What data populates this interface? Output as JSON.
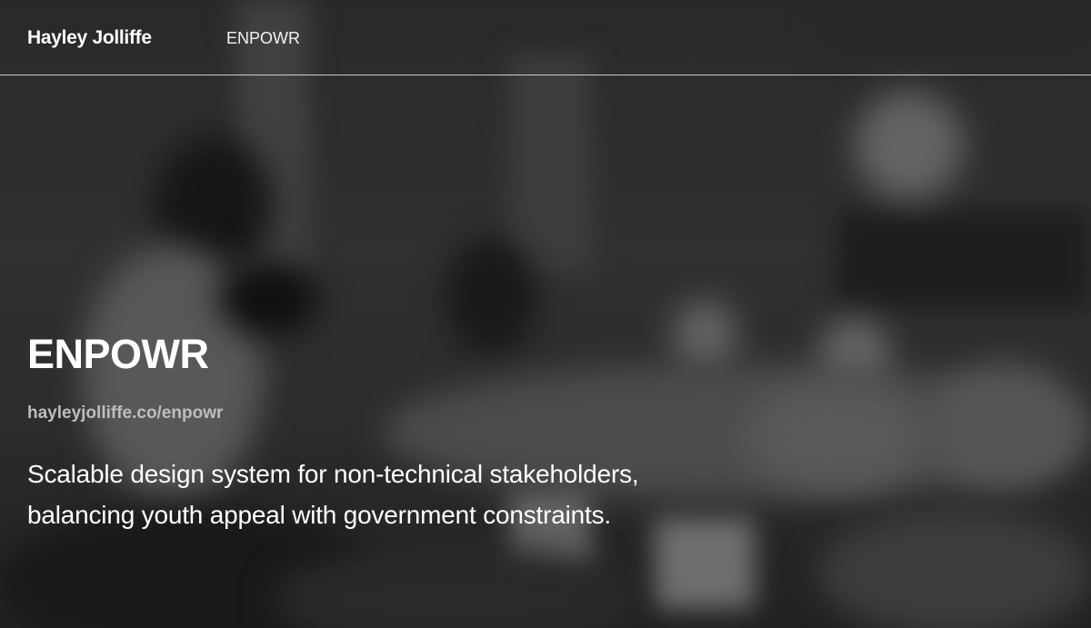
{
  "header": {
    "brand": "Hayley Jolliffe",
    "nav": [
      {
        "label": "ENPOWR"
      }
    ]
  },
  "hero": {
    "title": "ENPOWR",
    "url": "hayleyjolliffe.co/enpowr",
    "description_line1": "Scalable design system for non-technical stakeholders,",
    "description_line2": "balancing youth appeal with government constraints."
  },
  "colors": {
    "text": "#ffffff",
    "url_text": "#bdbdbd",
    "divider": "#ffffff",
    "background": "#2a2a2a"
  }
}
